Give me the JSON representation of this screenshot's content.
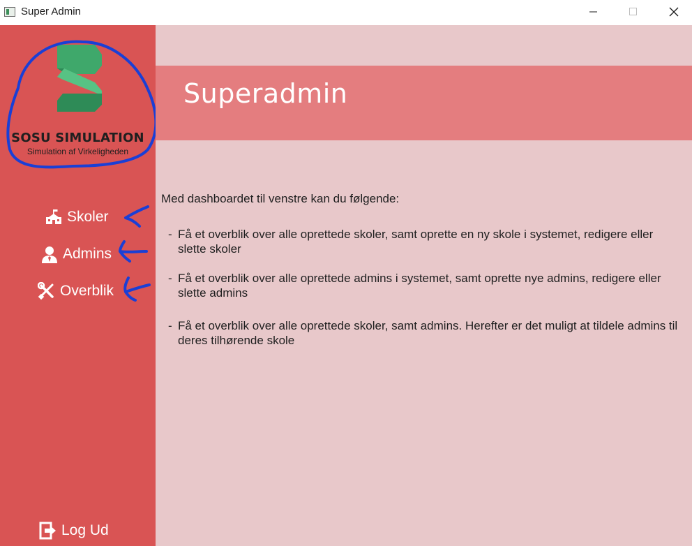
{
  "window": {
    "title": "Super Admin"
  },
  "sidebar": {
    "logo": {
      "wordmark": "SOSU SIMULATION",
      "tagline": "Simulation af Virkeligheden"
    },
    "items": [
      {
        "label": "Skoler",
        "icon": "school-icon"
      },
      {
        "label": "Admins",
        "icon": "user-icon"
      },
      {
        "label": "Overblik",
        "icon": "tools-icon"
      }
    ],
    "logout": {
      "label": "Log Ud",
      "icon": "logout-icon"
    }
  },
  "main": {
    "title": "Superadmin",
    "intro": "Med dashboardet til venstre kan du følgende:",
    "bullets": [
      "Få et overblik over alle oprettede skoler, samt oprette en ny skole i systemet, redigere eller slette skoler",
      "Få et overblik over alle oprettede admins i systemet, samt oprette nye admins, redigere eller slette admins",
      "Få et overblik over alle oprettede skoler, samt admins. Herefter er det muligt at tildele admins til deres tilhørende skole"
    ],
    "bullet_marker": "-"
  },
  "colors": {
    "sidebar": "#d95454",
    "content_bg": "#e8c8ca",
    "banner": "#e47d7f",
    "logo_green": "#3fa86b",
    "annotation_blue": "#1a3fd6"
  }
}
